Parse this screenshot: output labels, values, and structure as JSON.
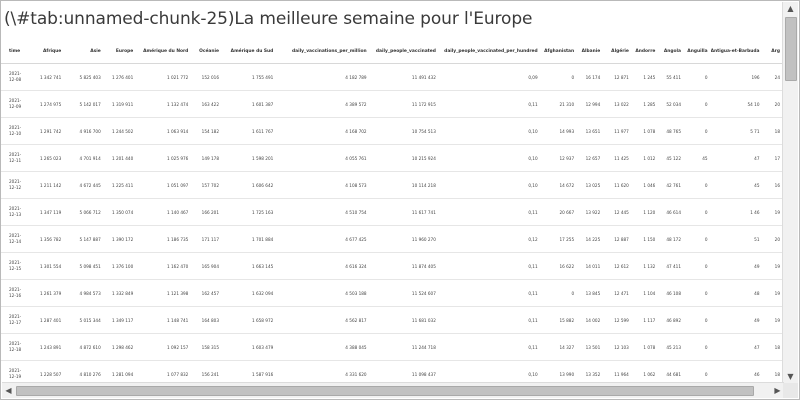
{
  "caption": "(\\#tab:unnamed-chunk-25)La meilleure semaine pour l'Europe",
  "table": {
    "columns": [
      "time",
      "Afrique",
      "Asie",
      "Europe",
      "Amérique du Nord",
      "Océanie",
      "Amérique du Sud",
      "daily_vaccinations_per_million",
      "daily_people_vaccinated",
      "daily_people_vaccinated_per_hundred",
      "Afghanistan",
      "Albanie",
      "Algérie",
      "Andorre",
      "Angola",
      "Anguilla",
      "Antigua-et-Barbuda",
      "Arg"
    ],
    "rows": [
      [
        "2021-12-08",
        "1 342 741",
        "5 825 403",
        "1 276 401",
        "1 021 772",
        "152 016",
        "1 755 491",
        "4 182 789",
        "11 491 432",
        "0,09",
        "0",
        "16 174",
        "12 871",
        "1 245",
        "55 411",
        "0",
        "196",
        "24"
      ],
      [
        "2021-12-09",
        "1 274 975",
        "5 142 017",
        "1 319 911",
        "1 132 474",
        "163 422",
        "1 601 387",
        "4 389 572",
        "11 172 915",
        "0,11",
        "21 310",
        "12 994",
        "13 022",
        "1 285",
        "52 034",
        "0",
        "54 10",
        "20"
      ],
      [
        "2021-12-10",
        "1 291 742",
        "4 916 700",
        "1 244 502",
        "1 063 914",
        "154 182",
        "1 611 767",
        "4 168 702",
        "10 754 513",
        "0,10",
        "14 993",
        "13 651",
        "11 977",
        "1 078",
        "48 765",
        "0",
        "5 71",
        "18"
      ],
      [
        "2021-12-11",
        "1 265 023",
        "4 701 914",
        "1 201 440",
        "1 025 976",
        "149 178",
        "1 598 201",
        "4 055 761",
        "10 215 924",
        "0,10",
        "12 937",
        "12 657",
        "11 425",
        "1 012",
        "45 122",
        "45",
        "47",
        "17"
      ],
      [
        "2021-12-12",
        "1 211 142",
        "4 672 445",
        "1 225 411",
        "1 051 097",
        "157 702",
        "1 606 642",
        "4 108 573",
        "10 114 218",
        "0,10",
        "14 672",
        "13 025",
        "11 620",
        "1 046",
        "42 761",
        "0",
        "45",
        "16"
      ],
      [
        "2021-12-13",
        "1 347 119",
        "5 066 712",
        "1 350 074",
        "1 140 467",
        "166 201",
        "1 725 163",
        "4 510 754",
        "11 617 741",
        "0,11",
        "20 667",
        "13 922",
        "12 445",
        "1 120",
        "46 614",
        "0",
        "1 46",
        "19"
      ],
      [
        "2021-12-14",
        "1 356 782",
        "5 147 887",
        "1 390 172",
        "1 186 735",
        "171 117",
        "1 701 884",
        "4 677 425",
        "11 960 270",
        "0,12",
        "17 255",
        "14 225",
        "12 887",
        "1 150",
        "48 172",
        "0",
        "51",
        "20"
      ],
      [
        "2021-12-15",
        "1 301 554",
        "5 098 451",
        "1 376 100",
        "1 162 470",
        "165 904",
        "1 663 145",
        "4 616 324",
        "11 874 405",
        "0,11",
        "16 622",
        "14 011",
        "12 612",
        "1 132",
        "47 411",
        "0",
        "49",
        "19"
      ],
      [
        "2021-12-16",
        "1 261 379",
        "4 984 573",
        "1 332 849",
        "1 121 398",
        "162 457",
        "1 632 094",
        "4 503 188",
        "11 524 607",
        "0,11",
        "0",
        "13 845",
        "12 471",
        "1 104",
        "46 108",
        "0",
        "48",
        "19"
      ],
      [
        "2021-12-17",
        "1 287 401",
        "5 015 344",
        "1 349 117",
        "1 148 741",
        "164 803",
        "1 658 972",
        "4 562 817",
        "11 681 032",
        "0,11",
        "15 882",
        "14 002",
        "12 599",
        "1 117",
        "46 892",
        "0",
        "49",
        "19"
      ],
      [
        "2021-12-18",
        "1 243 891",
        "4 872 610",
        "1 298 462",
        "1 092 157",
        "158 315",
        "1 603 479",
        "4 388 045",
        "11 244 718",
        "0,11",
        "14 327",
        "13 501",
        "12 103",
        "1 078",
        "45 213",
        "0",
        "47",
        "18"
      ],
      [
        "2021-12-19",
        "1 228 507",
        "4 810 276",
        "1 281 094",
        "1 077 832",
        "156 241",
        "1 587 916",
        "4 331 620",
        "11 098 437",
        "0,10",
        "13 990",
        "13 352",
        "11 964",
        "1 062",
        "44 681",
        "0",
        "46",
        "18"
      ]
    ]
  }
}
